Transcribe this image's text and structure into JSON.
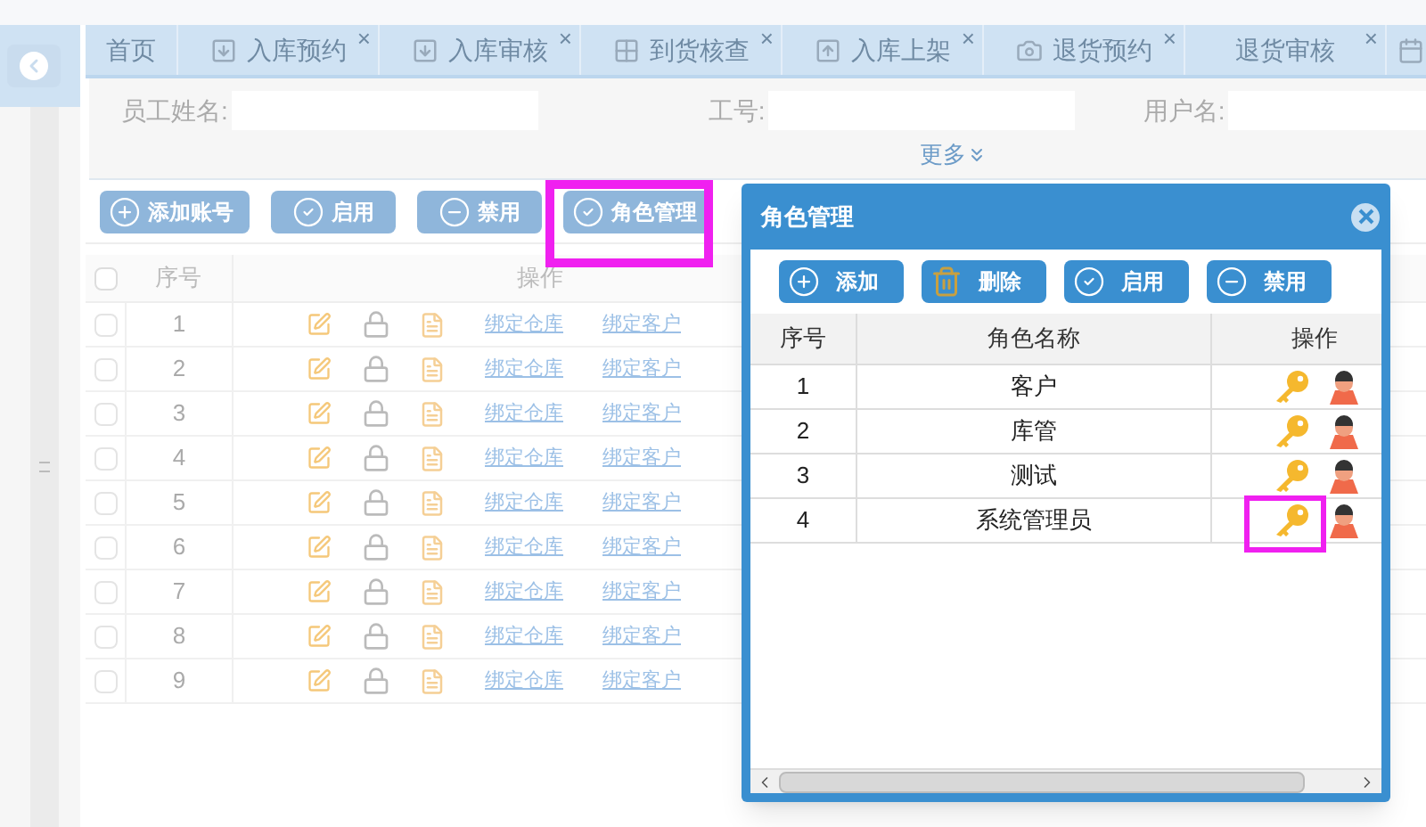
{
  "tabs": [
    {
      "label": "首页",
      "kind": "plain",
      "closable": false
    },
    {
      "label": "入库预约",
      "kind": "down",
      "closable": true
    },
    {
      "label": "入库审核",
      "kind": "down",
      "closable": true
    },
    {
      "label": "到货核查",
      "kind": "grid",
      "closable": true
    },
    {
      "label": "入库上架",
      "kind": "up",
      "closable": true
    },
    {
      "label": "退货预约",
      "kind": "camera",
      "closable": true
    },
    {
      "label": "退货审核",
      "kind": "plain",
      "closable": true
    },
    {
      "kind": "calendar",
      "closable": false
    }
  ],
  "close_glyph": "×",
  "search": {
    "fields": [
      {
        "label": "员工姓名:"
      },
      {
        "label": "工号:"
      },
      {
        "label": "用户名:"
      }
    ],
    "more": "更多"
  },
  "toolbar": [
    {
      "label": "添加账号",
      "kind": "plus"
    },
    {
      "label": "启用",
      "kind": "check"
    },
    {
      "label": "禁用",
      "kind": "minus"
    },
    {
      "label": "角色管理",
      "kind": "check"
    }
  ],
  "table": {
    "columns": [
      "序号",
      "操作"
    ],
    "header_checked": false,
    "rows": [
      {
        "checked": false,
        "index": "1",
        "links": [
          "绑定仓库",
          "绑定客户"
        ]
      },
      {
        "checked": false,
        "index": "2",
        "links": [
          "绑定仓库",
          "绑定客户"
        ]
      },
      {
        "checked": false,
        "index": "3",
        "links": [
          "绑定仓库",
          "绑定客户"
        ]
      },
      {
        "checked": false,
        "index": "4",
        "links": [
          "绑定仓库",
          "绑定客户"
        ]
      },
      {
        "checked": false,
        "index": "5",
        "links": [
          "绑定仓库",
          "绑定客户"
        ]
      },
      {
        "checked": false,
        "index": "6",
        "links": [
          "绑定仓库",
          "绑定客户"
        ]
      },
      {
        "checked": false,
        "index": "7",
        "links": [
          "绑定仓库",
          "绑定客户"
        ]
      },
      {
        "checked": false,
        "index": "8",
        "links": [
          "绑定仓库",
          "绑定客户"
        ]
      },
      {
        "checked": false,
        "index": "9",
        "links": [
          "绑定仓库",
          "绑定客户"
        ]
      }
    ]
  },
  "dialog": {
    "title": "角色管理",
    "buttons": [
      {
        "label": "添加",
        "kind": "plus"
      },
      {
        "label": "删除",
        "kind": "trash"
      },
      {
        "label": "启用",
        "kind": "check"
      },
      {
        "label": "禁用",
        "kind": "minus"
      }
    ],
    "columns": [
      "序号",
      "角色名称",
      "操作"
    ],
    "rows": [
      {
        "index": "1",
        "name": "客户"
      },
      {
        "index": "2",
        "name": "库管"
      },
      {
        "index": "3",
        "name": "测试"
      },
      {
        "index": "4",
        "name": "系统管理员"
      }
    ]
  }
}
